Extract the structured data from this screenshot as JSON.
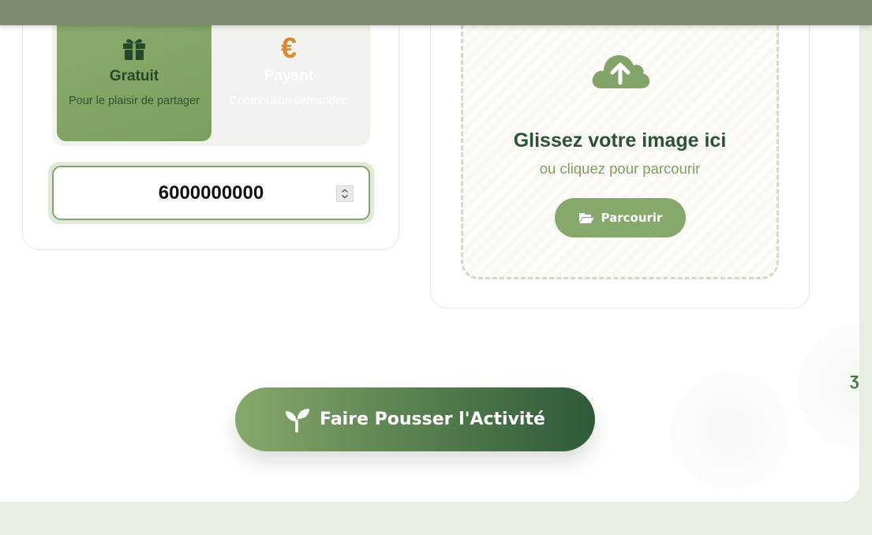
{
  "pricing": {
    "free": {
      "title": "Gratuit",
      "description": "Pour le plaisir de partager",
      "icon": "gift-icon",
      "selected": true
    },
    "paid": {
      "title": "Payant",
      "description": "Contribution demandée",
      "icon": "euro-icon",
      "symbol": "€",
      "selected": false
    }
  },
  "amount": {
    "value": "6000000000"
  },
  "upload": {
    "icon": "cloud-upload-icon",
    "title": "Glissez votre image ici",
    "subtitle": "ou cliquez pour parcourir",
    "browse_label": "Parcourir",
    "browse_icon": "folder-open-icon"
  },
  "submit": {
    "label": "Faire Pousser l'Activité",
    "icon": "seedling-icon"
  },
  "colors": {
    "primary": "#86a86a",
    "dark_green": "#2c5236",
    "accent_orange": "#d98a2e",
    "topbar": "#7f8a72"
  }
}
